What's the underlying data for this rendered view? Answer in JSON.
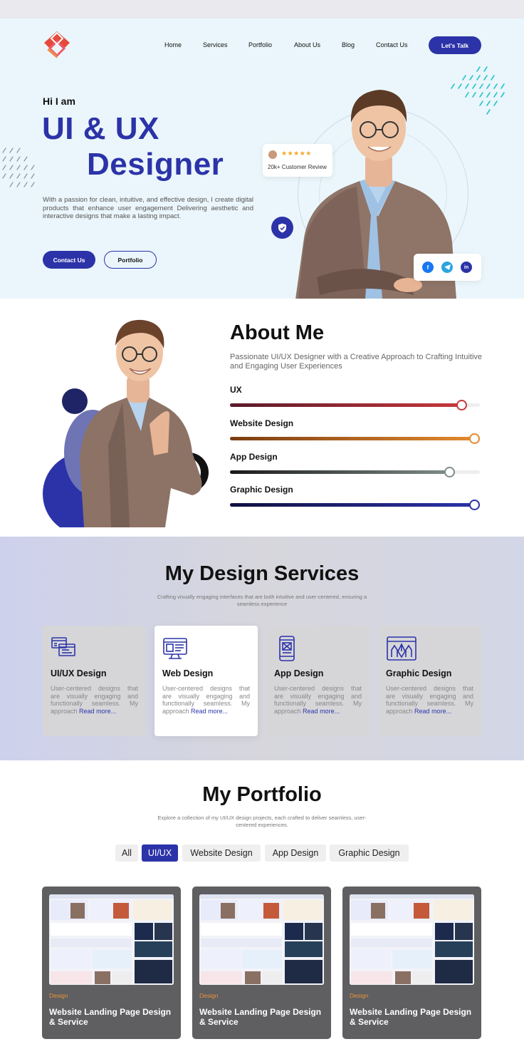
{
  "nav": {
    "items": [
      "Home",
      "Services",
      "Portfolio",
      "About Us",
      "Blog",
      "Contact Us"
    ],
    "cta": "Let's Talk"
  },
  "hero": {
    "greeting": "Hi I am",
    "title_line1": "UI & UX",
    "title_line2": "Designer",
    "description": "With a passion for clean, intuitive, and effective design, I create digital products that enhance user engagement Delivering aesthetic and interactive designs that make a lasting impact.",
    "primary_button": "Contact Us",
    "secondary_button": "Portfolio",
    "review": {
      "stars": "★★★★★",
      "text": "20k+ Customer Review"
    },
    "socials": [
      "facebook-icon",
      "telegram-icon",
      "linkedin-icon"
    ]
  },
  "about": {
    "title": "About Me",
    "subtitle": "Passionate UI/UX Designer with a Creative Approach to Crafting Intuitive and Engaging User Experiences",
    "skills": [
      {
        "label": "UX",
        "level": 0.93,
        "color_start": "#5a1a2a",
        "color_end": "#c8383c"
      },
      {
        "label": "Website Design",
        "level": 0.99,
        "color_start": "#7a3d12",
        "color_end": "#e58a2e"
      },
      {
        "label": "App Design",
        "level": 0.88,
        "color_start": "#1a1a1a",
        "color_end": "#7f8c88"
      },
      {
        "label": "Graphic Design",
        "level": 0.99,
        "color_start": "#101040",
        "color_end": "#2c33a8"
      }
    ]
  },
  "services": {
    "title": "My Design Services",
    "subtitle": "Crafting visually engaging interfaces that are both intuitive and user-centered, ensuring a seamless experience",
    "cards": [
      {
        "title": "UI/UX Design",
        "desc": "User-centered designs that are visually engaging and functionally seamless. My approach",
        "read_more": "Read more...",
        "icon": "ui-layout-icon"
      },
      {
        "title": "Web Design",
        "desc": "User-centered designs that are visually engaging and functionally seamless. My approach",
        "read_more": "Read more...",
        "icon": "web-monitor-icon"
      },
      {
        "title": "App Design",
        "desc": "User-centered designs that are visually engaging and functionally seamless. My approach",
        "read_more": "Read more...",
        "icon": "mobile-app-icon"
      },
      {
        "title": "Graphic Design",
        "desc": "User-centered designs that are visually engaging and functionally seamless. My approach",
        "read_more": "Read more...",
        "icon": "pen-tools-icon"
      }
    ]
  },
  "portfolio": {
    "title": "My Portfolio",
    "subtitle": "Explore a collection of my UI/UX design projects, each crafted to deliver seamless, user-centered experiences.",
    "filters": [
      "All",
      "UI/UX",
      "Website Design",
      "App Design",
      "Graphic Design"
    ],
    "active_filter": "UI/UX",
    "items": [
      {
        "category": "Design",
        "title": "Website Landing Page Design & Service"
      },
      {
        "category": "Design",
        "title": "Website Landing Page Design & Service"
      },
      {
        "category": "Design",
        "title": "Website Landing Page Design & Service"
      }
    ]
  },
  "colors": {
    "brand": "#2c33a8",
    "hero_bg": "#eaf6fb",
    "accent_orange": "#e8943d",
    "accent_teal": "#29c3cf"
  }
}
